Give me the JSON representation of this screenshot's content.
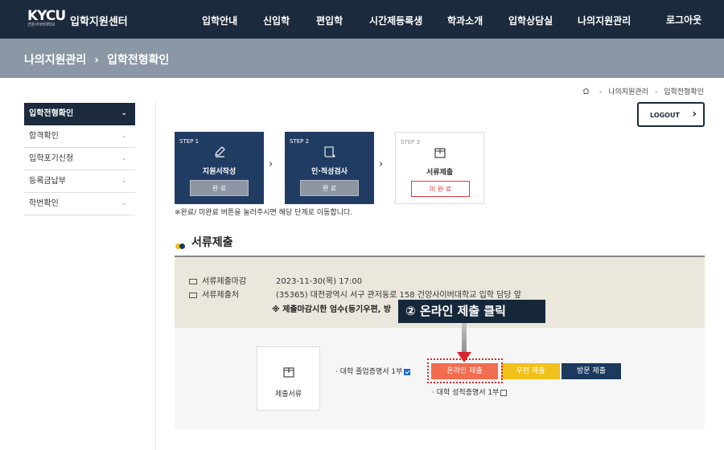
{
  "header": {
    "logo_mark": "KYCU",
    "logo_sub": "건양사이버대학교",
    "site_title": "입학지원센터",
    "nav": [
      "입학안내",
      "신입학",
      "편입학",
      "시간제등록생",
      "학과소개",
      "입학상담실",
      "나의지원관리"
    ],
    "login": "로그아웃"
  },
  "subbar": {
    "section": "나의지원관리",
    "arrow": "›",
    "page": "입학전형확인"
  },
  "breadcrumb": {
    "items": [
      "나의지원관리",
      "입학전형확인"
    ]
  },
  "sidebar": {
    "items": [
      {
        "label": "입학전형확인",
        "active": true
      },
      {
        "label": "합격확인"
      },
      {
        "label": "입학포기신청"
      },
      {
        "label": "등록금납부"
      },
      {
        "label": "학번확인"
      }
    ]
  },
  "logout_button": "LOGOUT",
  "steps": [
    {
      "label": "STEP 1",
      "name": "지원서작성",
      "status": "완 료",
      "icon": "pencil-icon"
    },
    {
      "label": "STEP 2",
      "name": "인·적성검사",
      "status": "완 료",
      "icon": "scroll-icon"
    },
    {
      "label": "STEP 3",
      "name": "서류제출",
      "status": "미 완 료",
      "icon": "box-icon"
    }
  ],
  "steps_note": "※완료/ 미완료 버튼을 눌러주시면 해당 단계로 이동합니다.",
  "section_title": "서류제출",
  "info": {
    "deadline_label": "서류제출마감",
    "deadline_value": "2023-11-30(목) 17:00",
    "address_label": "서류제출처",
    "address_value": "(35365) 대전광역시 서구 관저동로 158 건양사이버대학교 입학 담당 앞",
    "warning": "※ 제출마감시한 엄수(등기우편, 방"
  },
  "submit": {
    "doc_card_label": "제출서류",
    "doc1": "· 대학 졸업증명서 1부",
    "doc2": "· 대학 성적증명서 1부",
    "buttons": {
      "online": "온라인 제출",
      "post": "우편 제출",
      "visit": "방문 제출"
    }
  },
  "callout": "② 온라인 제출 클릭",
  "colors": {
    "navy": "#1b2a3c",
    "online": "#f26c4f",
    "post": "#f2c01a",
    "visit": "#1b3a5e",
    "highlight": "#d9232d"
  }
}
